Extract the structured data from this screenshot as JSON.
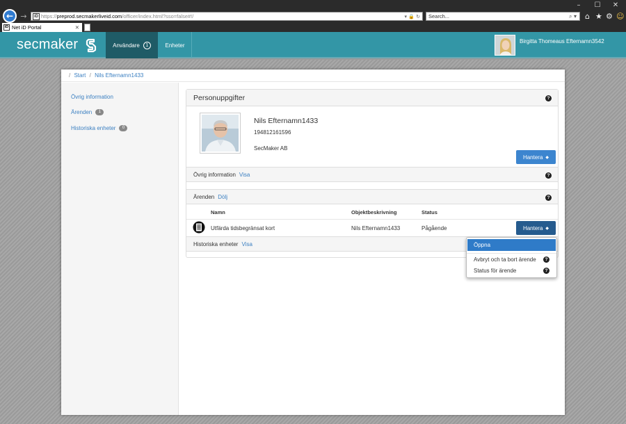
{
  "browser": {
    "url_prefix": "https://",
    "url_domain": "preprod.secmakerliveid.com",
    "url_rest": "/officer/index.html?sso=false#!/",
    "search_placeholder": "Search...",
    "tab_title": "Net iD Portal",
    "tab_favicon": "iD"
  },
  "header": {
    "brand": "secmaker",
    "nav": [
      {
        "label": "Användare",
        "count": "1"
      },
      {
        "label": "Enheter"
      }
    ],
    "user_name": "Birgitta Thomeaus Efternamn3542"
  },
  "breadcrumb": {
    "sep": "/",
    "items": [
      "Start",
      "Nils Efternamn1433"
    ]
  },
  "sidebar": {
    "items": [
      {
        "label": "Övrig information"
      },
      {
        "label": "Ärenden",
        "badge": "1"
      },
      {
        "label": "Historiska enheter",
        "badge": "0"
      }
    ]
  },
  "panel": {
    "title": "Personuppgifter",
    "person": {
      "name": "Nils Efternamn1433",
      "id_number": "194812161596",
      "organization": "SecMaker AB"
    },
    "manage_label": "Hantera",
    "sections": {
      "other_info": {
        "title": "Övrig information",
        "link": "Visa"
      },
      "cases": {
        "title": "Ärenden",
        "link": "Dölj"
      },
      "history": {
        "title": "Historiska enheter",
        "link": "Visa"
      }
    },
    "cases_table": {
      "columns": [
        "Namn",
        "Objektbeskrivning",
        "Status"
      ],
      "rows": [
        {
          "name": "Utfärda tidsbegränsat kort",
          "object": "Nils Efternamn1433",
          "status": "Pågående",
          "action": "Hantera"
        }
      ]
    }
  },
  "dropdown": {
    "items": [
      "Öppna",
      "Avbryt och ta bort ärende",
      "Status för ärende"
    ]
  },
  "colors": {
    "header_bg": "#3396a6",
    "nav_active_bg": "#1f5b66",
    "primary_button": "#3c85cf",
    "primary_button_dark": "#255b8e",
    "link": "#3a7fc1"
  }
}
